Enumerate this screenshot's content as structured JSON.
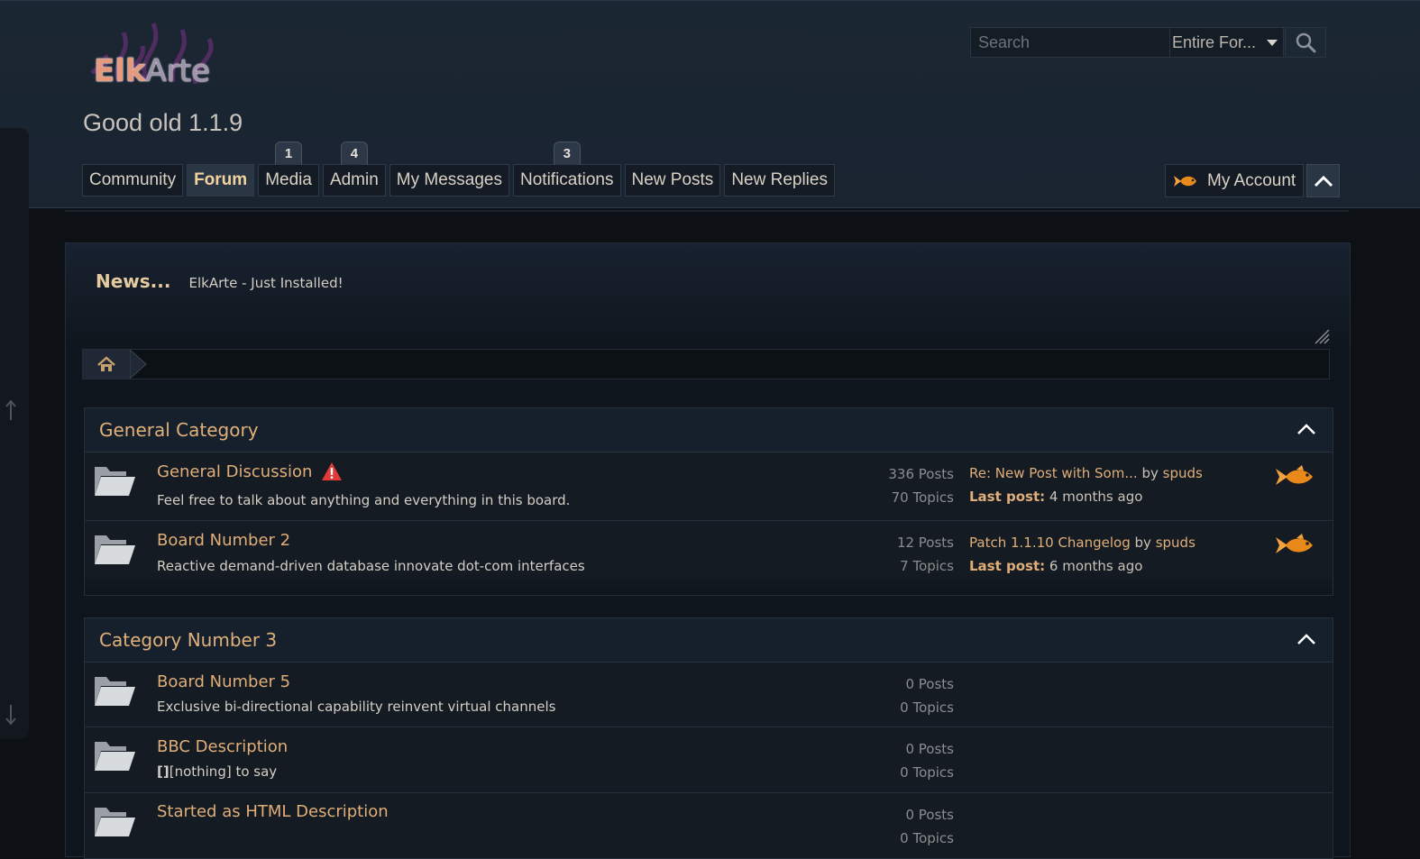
{
  "logo": {
    "part1": "Elk",
    "part2": "Arte"
  },
  "site_title": "Good old 1.1.9",
  "search": {
    "placeholder": "Search",
    "scope": "Entire For..."
  },
  "nav": [
    {
      "label": "Community",
      "badge": null
    },
    {
      "label": "Forum",
      "badge": null,
      "active": true
    },
    {
      "label": "Media",
      "badge": "1"
    },
    {
      "label": "Admin",
      "badge": "4"
    },
    {
      "label": "My Messages",
      "badge": null
    },
    {
      "label": "Notifications",
      "badge": "3"
    },
    {
      "label": "New Posts",
      "badge": null
    },
    {
      "label": "New Replies",
      "badge": null
    }
  ],
  "account": {
    "label": "My Account"
  },
  "news": {
    "label": "News...",
    "text": "ElkArte - Just Installed!"
  },
  "categories": [
    {
      "title": "General Category",
      "boards": [
        {
          "name": "General Discussion",
          "desc": "Feel free to talk about anything and everything in this board.",
          "posts": "336 Posts",
          "topics": "70 Topics",
          "last_title": "Re: New Post with Som...",
          "by": "by",
          "author": "spuds",
          "last_label": "Last post:",
          "last_time": "4 months ago"
        },
        {
          "name": "Board Number 2",
          "desc": "Reactive demand-driven database innovate dot-com interfaces",
          "posts": "12 Posts",
          "topics": "7 Topics",
          "last_title": "Patch 1.1.10 Changelog",
          "by": "by",
          "author": "spuds",
          "last_label": "Last post:",
          "last_time": "6 months ago"
        }
      ]
    },
    {
      "title": "Category Number 3",
      "boards": [
        {
          "name": "Board Number 5",
          "desc": "Exclusive bi-directional capability reinvent virtual channels",
          "posts": "0 Posts",
          "topics": "0 Topics"
        },
        {
          "name": "BBC Description",
          "desc_bold": "[]",
          "desc": "[nothing] to say",
          "posts": "0 Posts",
          "topics": "0 Topics"
        },
        {
          "name": "Started as HTML Description",
          "posts": "0 Posts",
          "topics": "0 Topics"
        }
      ]
    }
  ],
  "colors": {
    "accent": "#e0ae79",
    "header_bg": "#1b2633",
    "page_bg": "#0d1115"
  }
}
